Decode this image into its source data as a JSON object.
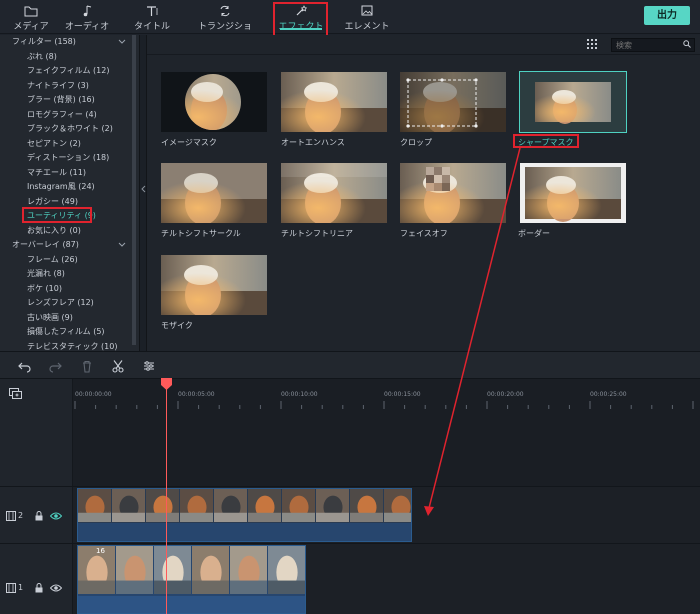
{
  "toolbar": {
    "tabs": [
      {
        "label": "メディア",
        "icon": "folder-icon"
      },
      {
        "label": "オーディオ",
        "icon": "music-note-icon"
      },
      {
        "label": "タイトル",
        "icon": "title-text-icon"
      },
      {
        "label": "トランジション",
        "icon": "transition-icon"
      },
      {
        "label": "エフェクト",
        "icon": "effects-icon"
      },
      {
        "label": "エレメント",
        "icon": "element-image-icon"
      }
    ],
    "active_tab": "エフェクト",
    "export_label": "出力"
  },
  "sidebar": {
    "items": [
      {
        "label": "フィルター (158)",
        "level": "group",
        "expanded": true
      },
      {
        "label": "ぶれ (8)",
        "level": "item"
      },
      {
        "label": "フェイクフィルム (12)",
        "level": "item"
      },
      {
        "label": "ナイトライフ (3)",
        "level": "item"
      },
      {
        "label": "ブラー (背景) (16)",
        "level": "item"
      },
      {
        "label": "ロモグラフィー (4)",
        "level": "item"
      },
      {
        "label": "ブラック＆ホワイト (2)",
        "level": "item"
      },
      {
        "label": "セピアトン (2)",
        "level": "item"
      },
      {
        "label": "ディストーション (18)",
        "level": "item"
      },
      {
        "label": "マチエール (11)",
        "level": "item"
      },
      {
        "label": "Instagram風 (24)",
        "level": "item"
      },
      {
        "label": "レガシー (49)",
        "level": "item"
      },
      {
        "label": "ユーティリティ (9)",
        "level": "item",
        "selected": true
      },
      {
        "label": "お気に入り (0)",
        "level": "item"
      },
      {
        "label": "オーバーレイ (87)",
        "level": "group",
        "expanded": true
      },
      {
        "label": "フレーム (26)",
        "level": "item"
      },
      {
        "label": "光漏れ (8)",
        "level": "item"
      },
      {
        "label": "ボケ (10)",
        "level": "item"
      },
      {
        "label": "レンズフレア (12)",
        "level": "item"
      },
      {
        "label": "古い映画 (9)",
        "level": "item"
      },
      {
        "label": "損傷したフィルム (5)",
        "level": "item"
      },
      {
        "label": "テレビスタティック (10)",
        "level": "item"
      }
    ]
  },
  "search": {
    "placeholder": "検索"
  },
  "effects": [
    {
      "label": "イメージマスク"
    },
    {
      "label": "オートエンハンス"
    },
    {
      "label": "クロップ"
    },
    {
      "label": "シャープマスク",
      "selected": true
    },
    {
      "label": "チルトシフトサークル"
    },
    {
      "label": "チルトシフトリニア"
    },
    {
      "label": "フェイスオフ"
    },
    {
      "label": "ボーダー"
    },
    {
      "label": "モザイク"
    }
  ],
  "timeline": {
    "ruler_labels": [
      "00:00:00:00",
      "00:00:05:00",
      "00:00:10:00",
      "00:00:15:00",
      "00:00:20:00",
      "00:00:25:00"
    ],
    "tracks": [
      {
        "number": "2",
        "visible": true
      },
      {
        "number": "1",
        "visible": true
      }
    ],
    "clip_label": "16"
  },
  "colors": {
    "accent": "#4fd2c2",
    "highlight": "#e0232e",
    "playhead": "#ff5a5a"
  }
}
